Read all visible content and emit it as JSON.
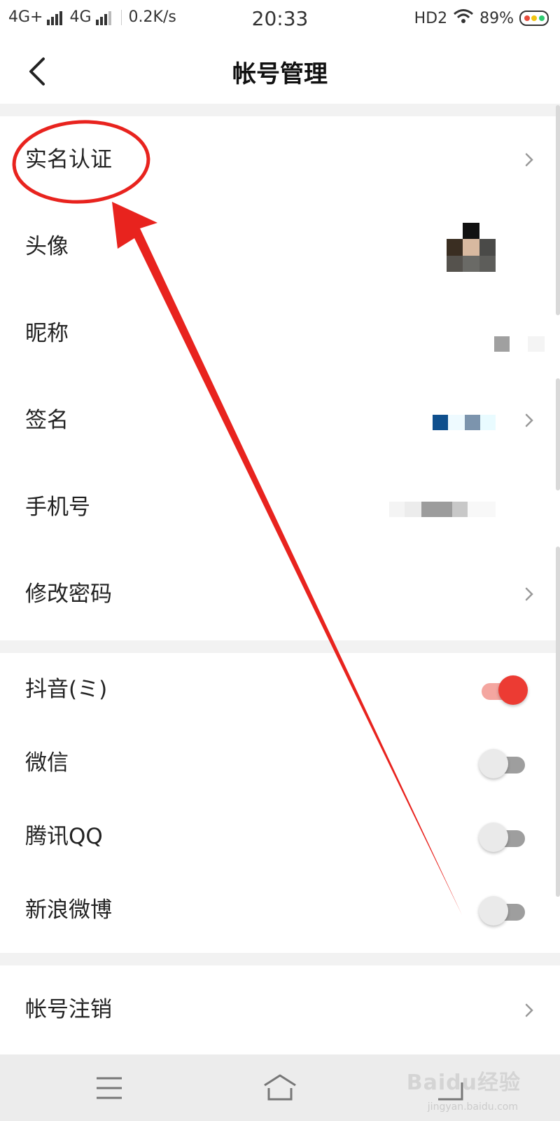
{
  "status_bar": {
    "network1": "4G+",
    "network2": "4G",
    "speed": "0.2K/s",
    "time": "20:33",
    "hd": "HD2",
    "battery_percent": "89%"
  },
  "header": {
    "title": "帐号管理",
    "back_icon": "chevron-left-icon"
  },
  "profile_section": {
    "items": [
      {
        "label": "实名认证",
        "has_chevron": true
      },
      {
        "label": "头像",
        "has_chevron": false
      },
      {
        "label": "昵称",
        "has_chevron": false
      },
      {
        "label": "签名",
        "has_chevron": true
      },
      {
        "label": "手机号",
        "has_chevron": false
      },
      {
        "label": "修改密码",
        "has_chevron": true
      }
    ]
  },
  "social_section": {
    "items": [
      {
        "label": "抖音(ミ)",
        "enabled": true
      },
      {
        "label": "微信",
        "enabled": false
      },
      {
        "label": "腾讯QQ",
        "enabled": false
      },
      {
        "label": "新浪微博",
        "enabled": false
      }
    ]
  },
  "account_section": {
    "cancel_label": "帐号注销"
  },
  "bottom_nav": {
    "icons": [
      "menu-icon",
      "home-icon",
      "back-icon"
    ]
  },
  "watermark": {
    "text": "Baidu经验",
    "sub": "jingyan.baidu.com"
  },
  "colors": {
    "accent_red": "#ec3b33",
    "annotation_red": "#e8231e",
    "background": "#f2f2f2"
  }
}
